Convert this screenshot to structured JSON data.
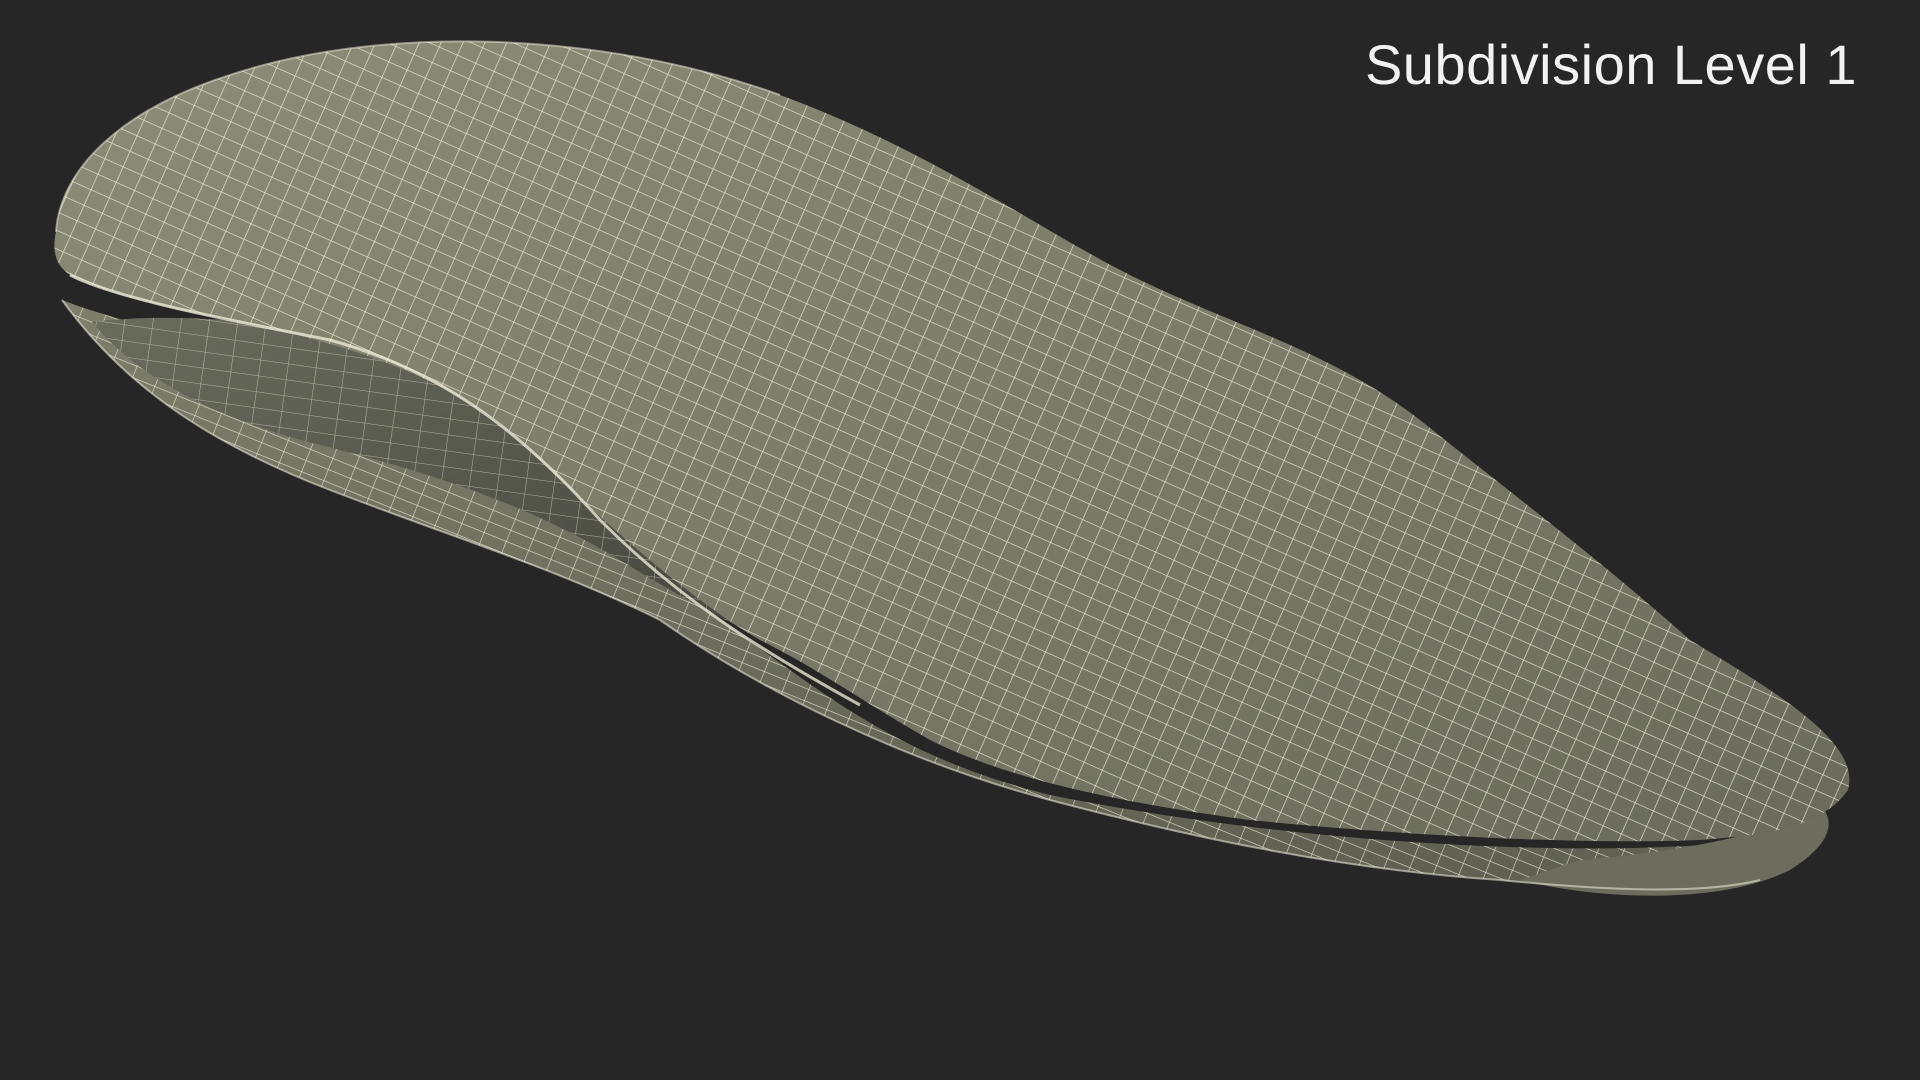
{
  "render": {
    "caption": "Subdivision Level 1",
    "background_color": "#262626",
    "surface_color": "#7b7c69",
    "inner_surface_color": "#5d5f52",
    "wire_color": "#f3f0dc",
    "object_icon": "wireframe-mesh"
  }
}
